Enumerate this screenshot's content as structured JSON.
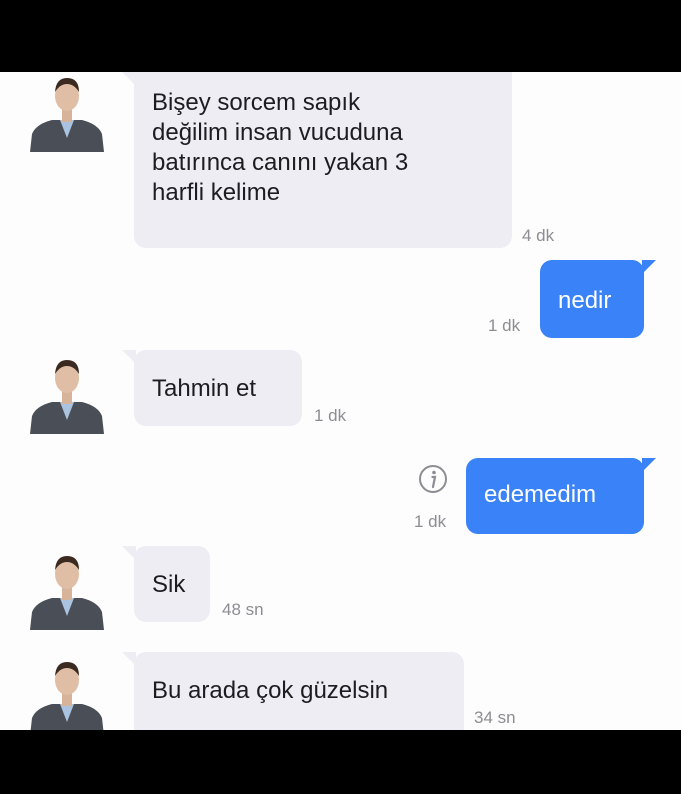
{
  "conversation": {
    "messages": [
      {
        "direction": "incoming",
        "text": "Bişey sorcem sapık değilim insan vucuduna batırınca canını yakan 3 harfli kelime",
        "time": "4 dk",
        "lines": [
          "Bişey sorcem sapık",
          "değilim insan vucuduna",
          "batırınca canını yakan 3",
          "harfli kelime"
        ]
      },
      {
        "direction": "outgoing",
        "text": "nedir",
        "time": "1 dk"
      },
      {
        "direction": "incoming",
        "text": "Tahmin et",
        "time": "1 dk"
      },
      {
        "direction": "outgoing",
        "text": "edemedim",
        "time": "1 dk",
        "status_icon": "info-icon"
      },
      {
        "direction": "incoming",
        "text": "Sik",
        "time": "48 sn"
      },
      {
        "direction": "incoming",
        "text": "Bu arada çok güzelsin",
        "time": "34 sn"
      }
    ]
  },
  "colors": {
    "incoming_bubble": "#efedf4",
    "outgoing_bubble": "#3a82f7",
    "background": "#fdfdfd",
    "timestamp": "#8d8d93",
    "frame": "#000000"
  }
}
